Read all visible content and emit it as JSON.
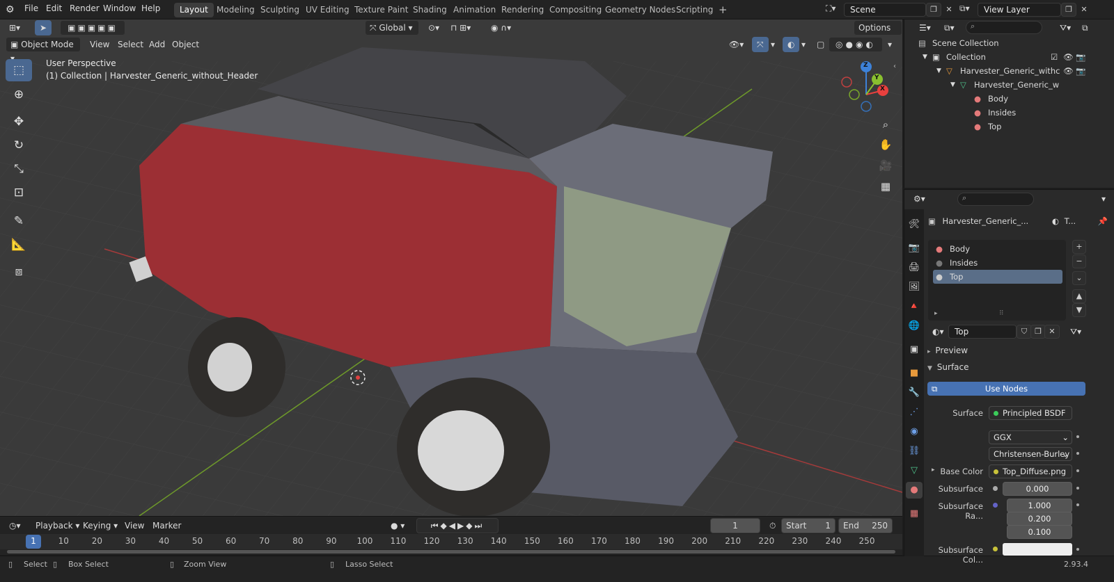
{
  "topbar": {
    "menus": [
      "File",
      "Edit",
      "Render",
      "Window",
      "Help"
    ],
    "workspaces": [
      "Layout",
      "Modeling",
      "Sculpting",
      "UV Editing",
      "Texture Paint",
      "Shading",
      "Animation",
      "Rendering",
      "Compositing",
      "Geometry Nodes",
      "Scripting"
    ],
    "active_workspace": "Layout",
    "scene": "Scene",
    "view_layer": "View Layer",
    "add_tab": "+"
  },
  "viewport": {
    "mode": "Object Mode",
    "menus": [
      "View",
      "Select",
      "Add",
      "Object"
    ],
    "transform_orientation": "Global",
    "options": "Options",
    "overlay_title": "User Perspective",
    "overlay_subtitle": "(1) Collection | Harvester_Generic_without_Header",
    "gizmo_axes": {
      "x": "X",
      "y": "Y",
      "z": "Z"
    }
  },
  "timeline": {
    "menus": [
      "Playback",
      "Keying",
      "View",
      "Marker"
    ],
    "current_frame": "1",
    "start_label": "Start",
    "start": "1",
    "end_label": "End",
    "end": "250",
    "ruler": [
      "1",
      "10",
      "20",
      "30",
      "40",
      "50",
      "60",
      "70",
      "80",
      "90",
      "100",
      "110",
      "120",
      "130",
      "140",
      "150",
      "160",
      "170",
      "180",
      "190",
      "200",
      "210",
      "220",
      "230",
      "240",
      "250"
    ]
  },
  "status": {
    "items": [
      "Select",
      "Box Select",
      "Zoom View",
      "Lasso Select"
    ],
    "version": "2.93.4"
  },
  "outliner": {
    "rows": [
      {
        "label": "Scene Collection",
        "icon": "scene-collection-icon",
        "indent": 0
      },
      {
        "label": "Collection",
        "icon": "collection-icon",
        "indent": 1
      },
      {
        "label": "Harvester_Generic_withc",
        "icon": "object-icon",
        "indent": 2
      },
      {
        "label": "Harvester_Generic_w",
        "icon": "mesh-icon",
        "indent": 3
      },
      {
        "label": "Body",
        "icon": "material-icon",
        "indent": 4
      },
      {
        "label": "Insides",
        "icon": "material-icon",
        "indent": 4
      },
      {
        "label": "Top",
        "icon": "material-icon",
        "indent": 4
      }
    ]
  },
  "properties": {
    "object_name": "Harvester_Generic_...",
    "material_short": "T...",
    "slots": [
      "Body",
      "Insides",
      "Top"
    ],
    "selected_slot": "Top",
    "material_name": "Top",
    "panels": {
      "preview": "Preview",
      "surface": "Surface"
    },
    "use_nodes": "Use Nodes",
    "surface_label": "Surface",
    "surface_value": "Principled BSDF",
    "distribution": "GGX",
    "subsurface_method": "Christensen-Burley",
    "base_color_label": "Base Color",
    "base_color_value": "Top_Diffuse.png",
    "subsurface_label": "Subsurface",
    "subsurface_value": "0.000",
    "subsurface_radius_label": "Subsurface Ra...",
    "subsurface_radius": [
      "1.000",
      "0.200",
      "0.100"
    ],
    "subsurface_color_label": "Subsurface Col..."
  },
  "colors": {
    "accent": "#4772b3",
    "selected_slot": "#5a6e88",
    "x_axis": "#e8403e",
    "y_axis": "#8ac02f",
    "z_axis": "#3d82d9"
  }
}
